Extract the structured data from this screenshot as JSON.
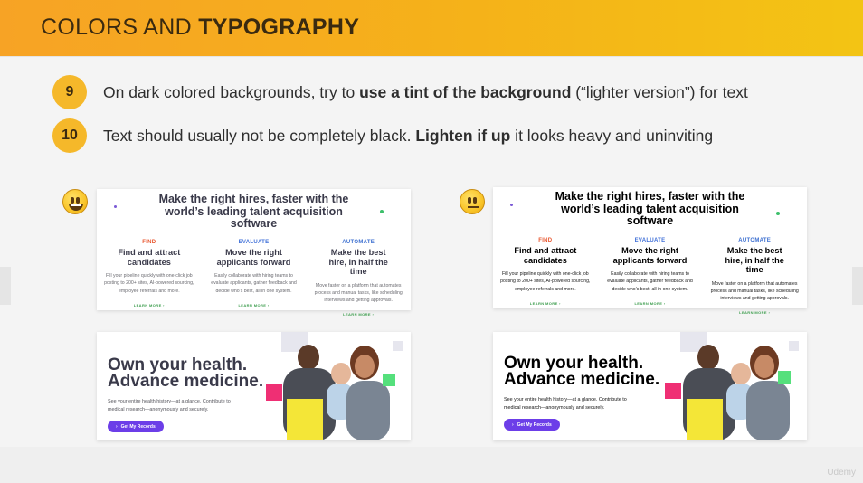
{
  "header": {
    "title_regular": "COLORS AND ",
    "title_bold": "TYPOGRAPHY"
  },
  "tips": [
    {
      "number": "9",
      "pre": "On dark colored backgrounds, try to ",
      "bold": "use a tint of the background",
      "post": " (“lighter version”) for text"
    },
    {
      "number": "10",
      "pre": "Text should usually not be completely black. ",
      "bold": "Lighten if up",
      "post": " it looks heavy and uninviting"
    }
  ],
  "emoji": {
    "good": "grinning-face-icon",
    "neutral": "neutral-face-icon"
  },
  "hire_card": {
    "title": "Make the right hires, faster with the world’s leading talent acquisition software",
    "columns": [
      {
        "label": "FIND",
        "heading": "Find and attract candidates",
        "body": "Fill your pipeline quickly with one-click job posting to 200+ sites, AI-powered sourcing, employee referrals and more.",
        "link": "LEARN MORE ›",
        "label_color": "#e8542c"
      },
      {
        "label": "EVALUATE",
        "heading": "Move the right applicants forward",
        "body": "Easily collaborate with hiring teams to evaluate applicants, gather feedback and decide who’s best, all in one system.",
        "link": "LEARN MORE ›",
        "label_color": "#3f6fd8"
      },
      {
        "label": "AUTOMATE",
        "heading": "Make the best hire, in half the time",
        "body": "Move faster on a platform that automates process and manual tasks, like scheduling interviews and getting approvals.",
        "link": "LEARN MORE ›",
        "label_color": "#3c6fd0"
      }
    ]
  },
  "health_card": {
    "title_line1": "Own your health.",
    "title_line2": "Advance medicine.",
    "body": "See your entire health history—at a glance. Contribute to medical research—anonymously and securely.",
    "button": "Get My Records",
    "button_color": "#6c3ee8"
  },
  "colors": {
    "header_gradient_start": "#f7a325",
    "header_gradient_end": "#f3c414",
    "tip_badge": "#f5b82a",
    "text_left": "#3a3a4a",
    "text_right": "#000000",
    "body_left": "#6a6a70",
    "body_right": "#1a1a1a"
  },
  "watermark": "Udemy"
}
